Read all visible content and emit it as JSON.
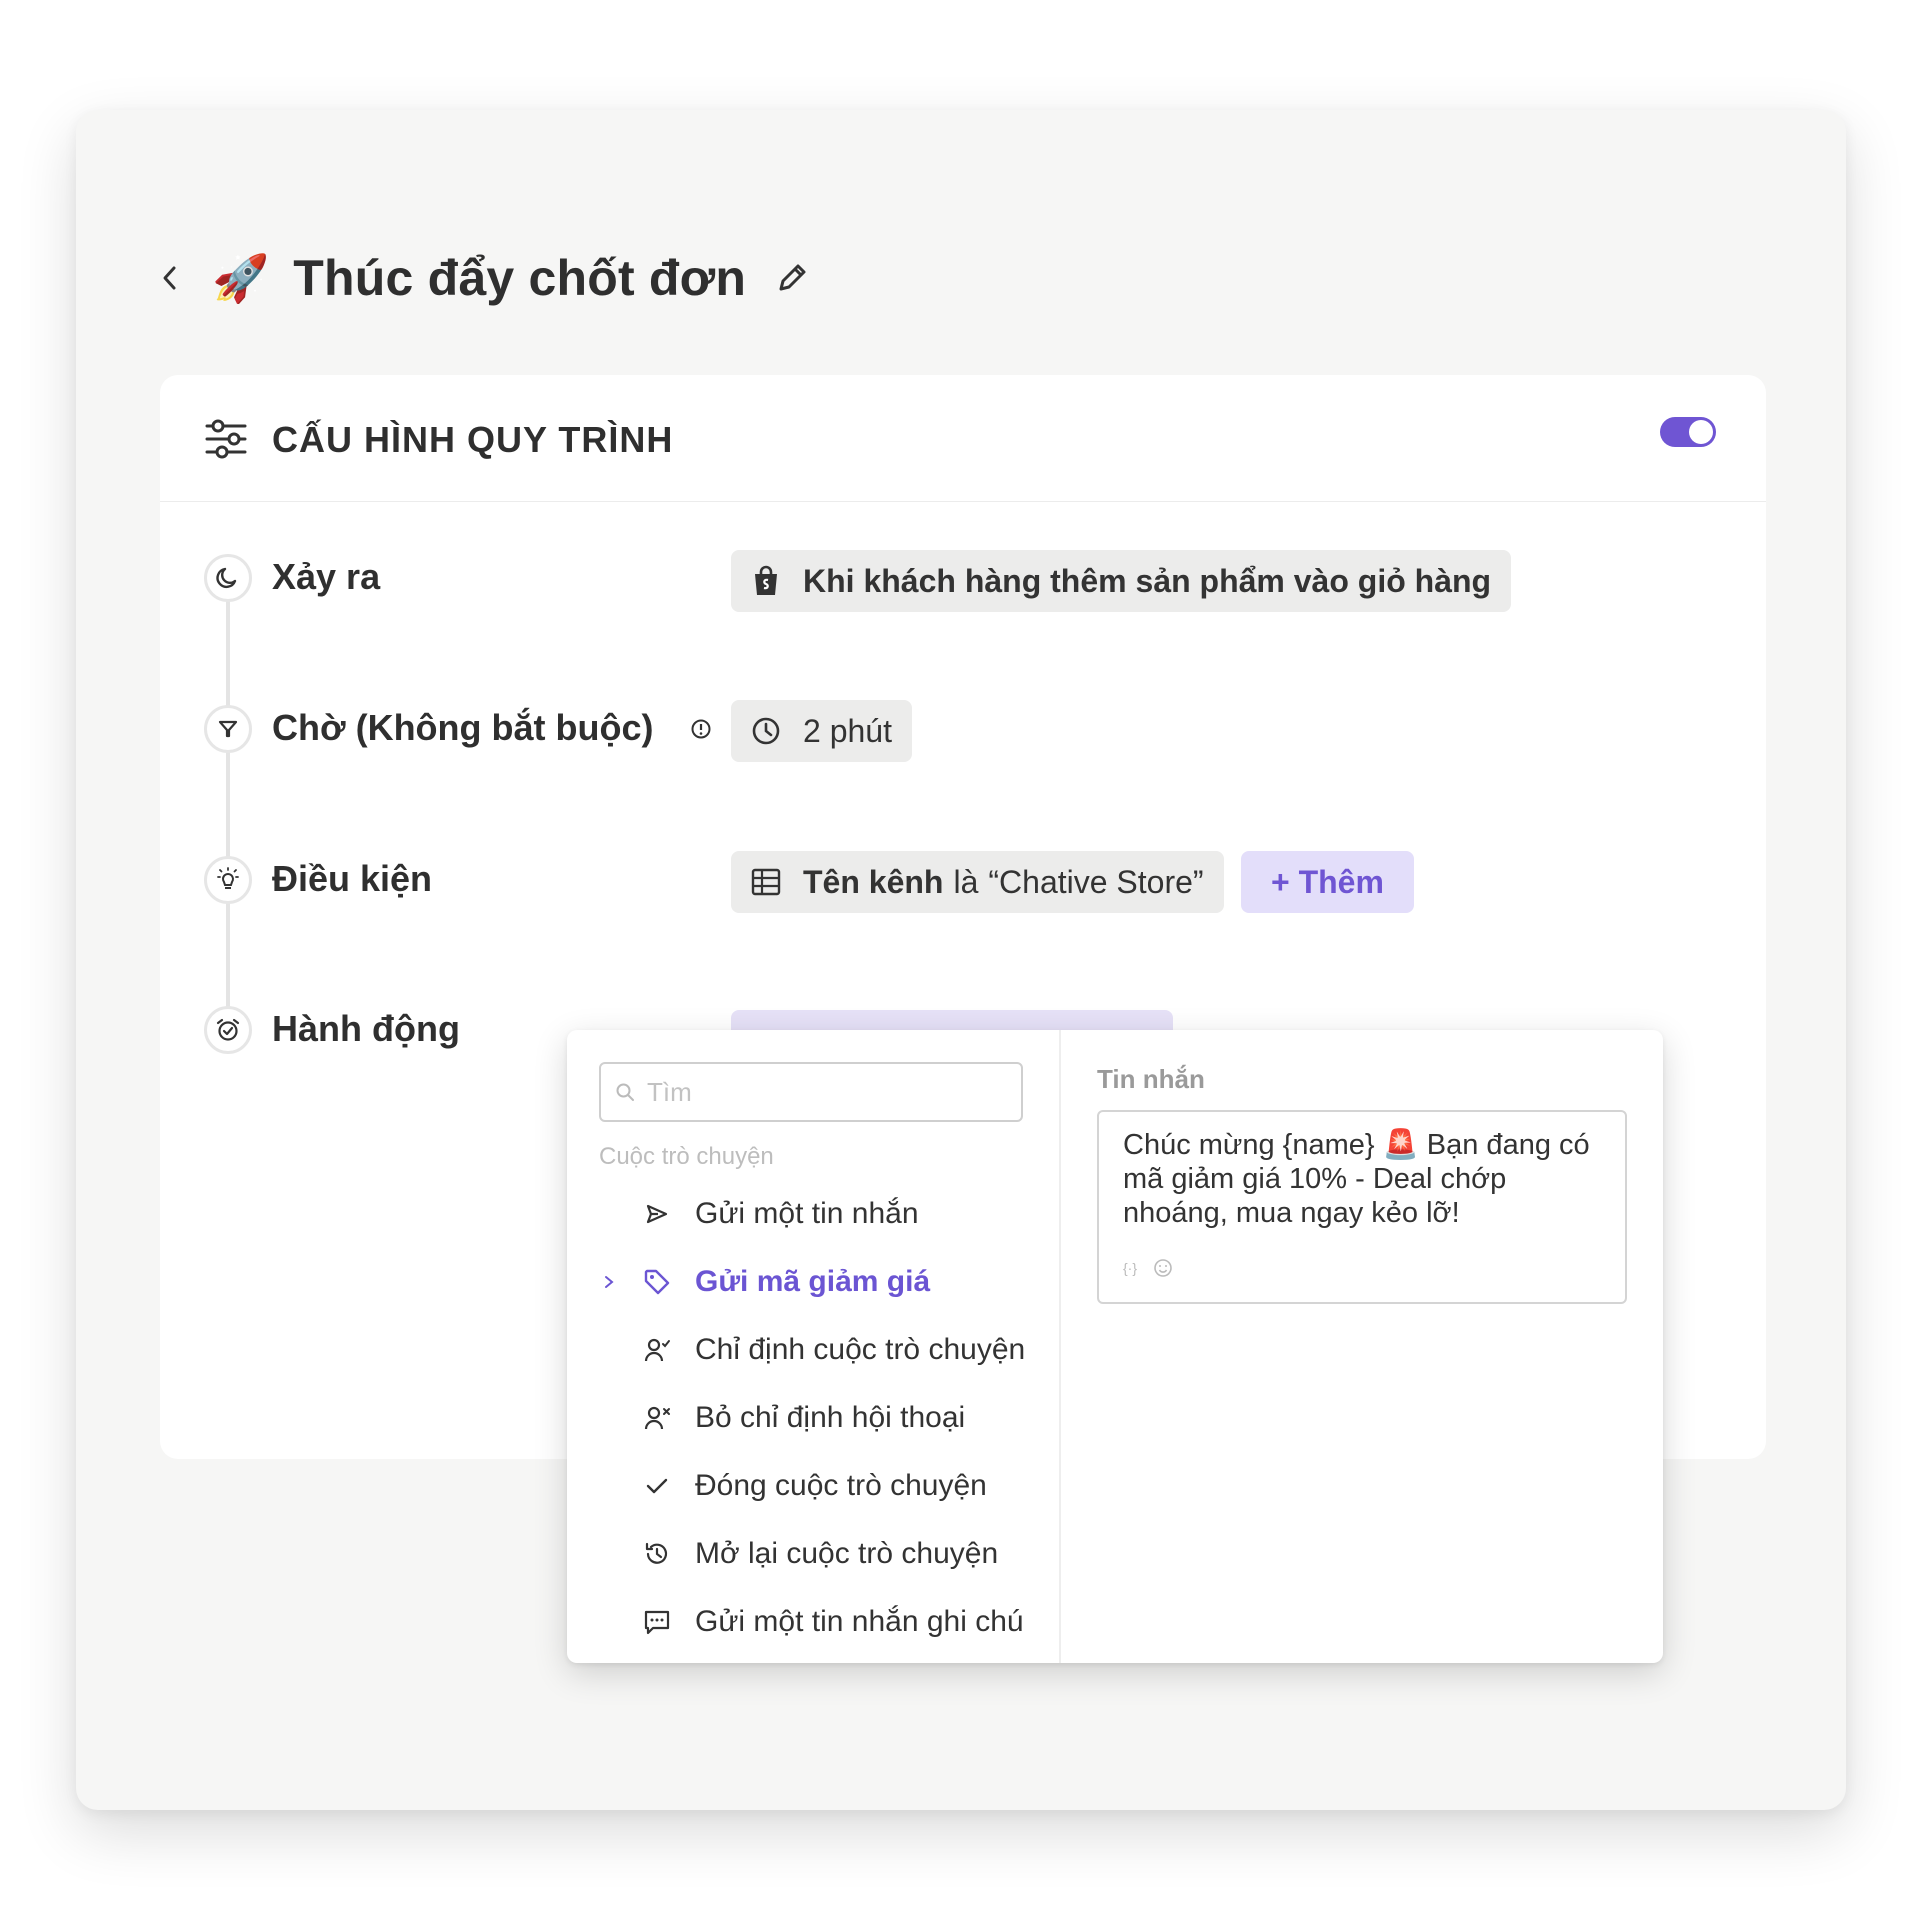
{
  "header": {
    "emoji": "🚀",
    "title": "Thúc đẩy chốt đơn"
  },
  "card": {
    "title": "CẤU HÌNH QUY TRÌNH",
    "toggle_on": true,
    "accent": "#6f55d3"
  },
  "steps": {
    "trigger": {
      "label": "Xảy ra",
      "value": "Khi khách hàng thêm sản phẩm vào giỏ hàng"
    },
    "wait": {
      "label": "Chờ (Không bắt buộc)",
      "value": "2 phút"
    },
    "condition": {
      "label": "Điều kiện",
      "field": "Tên kênh",
      "operator": "là",
      "value": "“Chative Store”",
      "add_label": "+ Thêm"
    },
    "action": {
      "label": "Hành động"
    }
  },
  "dropdown": {
    "search_placeholder": "Tìm",
    "group_label": "Cuộc trò chuyện",
    "items": [
      {
        "label": "Gửi một tin nhắn",
        "icon": "send-icon"
      },
      {
        "label": "Gửi mã giảm giá",
        "icon": "tag-icon",
        "active": true
      },
      {
        "label": "Chỉ định cuộc trò chuyện",
        "icon": "user-assign-icon"
      },
      {
        "label": "Bỏ chỉ định hội thoại",
        "icon": "user-unassign-icon"
      },
      {
        "label": "Đóng cuộc trò chuyện",
        "icon": "check-icon"
      },
      {
        "label": "Mở lại cuộc trò chuyện",
        "icon": "history-icon"
      },
      {
        "label": "Gửi một tin nhắn ghi chú",
        "icon": "note-message-icon"
      }
    ],
    "message": {
      "label": "Tin nhắn",
      "text": "Chúc mừng {name} 🚨 Bạn đang có mã giảm giá 10% - Deal chớp nhoáng, mua ngay kẻo lỡ!"
    }
  }
}
